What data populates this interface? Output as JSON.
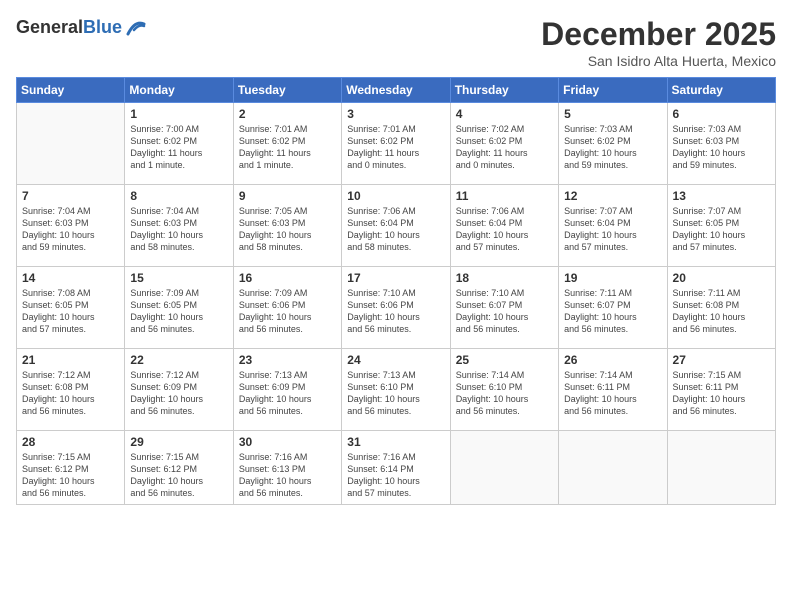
{
  "logo": {
    "general": "General",
    "blue": "Blue"
  },
  "title": "December 2025",
  "location": "San Isidro Alta Huerta, Mexico",
  "days_header": [
    "Sunday",
    "Monday",
    "Tuesday",
    "Wednesday",
    "Thursday",
    "Friday",
    "Saturday"
  ],
  "weeks": [
    [
      {
        "day": "",
        "info": ""
      },
      {
        "day": "1",
        "info": "Sunrise: 7:00 AM\nSunset: 6:02 PM\nDaylight: 11 hours\nand 1 minute."
      },
      {
        "day": "2",
        "info": "Sunrise: 7:01 AM\nSunset: 6:02 PM\nDaylight: 11 hours\nand 1 minute."
      },
      {
        "day": "3",
        "info": "Sunrise: 7:01 AM\nSunset: 6:02 PM\nDaylight: 11 hours\nand 0 minutes."
      },
      {
        "day": "4",
        "info": "Sunrise: 7:02 AM\nSunset: 6:02 PM\nDaylight: 11 hours\nand 0 minutes."
      },
      {
        "day": "5",
        "info": "Sunrise: 7:03 AM\nSunset: 6:02 PM\nDaylight: 10 hours\nand 59 minutes."
      },
      {
        "day": "6",
        "info": "Sunrise: 7:03 AM\nSunset: 6:03 PM\nDaylight: 10 hours\nand 59 minutes."
      }
    ],
    [
      {
        "day": "7",
        "info": "Sunrise: 7:04 AM\nSunset: 6:03 PM\nDaylight: 10 hours\nand 59 minutes."
      },
      {
        "day": "8",
        "info": "Sunrise: 7:04 AM\nSunset: 6:03 PM\nDaylight: 10 hours\nand 58 minutes."
      },
      {
        "day": "9",
        "info": "Sunrise: 7:05 AM\nSunset: 6:03 PM\nDaylight: 10 hours\nand 58 minutes."
      },
      {
        "day": "10",
        "info": "Sunrise: 7:06 AM\nSunset: 6:04 PM\nDaylight: 10 hours\nand 58 minutes."
      },
      {
        "day": "11",
        "info": "Sunrise: 7:06 AM\nSunset: 6:04 PM\nDaylight: 10 hours\nand 57 minutes."
      },
      {
        "day": "12",
        "info": "Sunrise: 7:07 AM\nSunset: 6:04 PM\nDaylight: 10 hours\nand 57 minutes."
      },
      {
        "day": "13",
        "info": "Sunrise: 7:07 AM\nSunset: 6:05 PM\nDaylight: 10 hours\nand 57 minutes."
      }
    ],
    [
      {
        "day": "14",
        "info": "Sunrise: 7:08 AM\nSunset: 6:05 PM\nDaylight: 10 hours\nand 57 minutes."
      },
      {
        "day": "15",
        "info": "Sunrise: 7:09 AM\nSunset: 6:05 PM\nDaylight: 10 hours\nand 56 minutes."
      },
      {
        "day": "16",
        "info": "Sunrise: 7:09 AM\nSunset: 6:06 PM\nDaylight: 10 hours\nand 56 minutes."
      },
      {
        "day": "17",
        "info": "Sunrise: 7:10 AM\nSunset: 6:06 PM\nDaylight: 10 hours\nand 56 minutes."
      },
      {
        "day": "18",
        "info": "Sunrise: 7:10 AM\nSunset: 6:07 PM\nDaylight: 10 hours\nand 56 minutes."
      },
      {
        "day": "19",
        "info": "Sunrise: 7:11 AM\nSunset: 6:07 PM\nDaylight: 10 hours\nand 56 minutes."
      },
      {
        "day": "20",
        "info": "Sunrise: 7:11 AM\nSunset: 6:08 PM\nDaylight: 10 hours\nand 56 minutes."
      }
    ],
    [
      {
        "day": "21",
        "info": "Sunrise: 7:12 AM\nSunset: 6:08 PM\nDaylight: 10 hours\nand 56 minutes."
      },
      {
        "day": "22",
        "info": "Sunrise: 7:12 AM\nSunset: 6:09 PM\nDaylight: 10 hours\nand 56 minutes."
      },
      {
        "day": "23",
        "info": "Sunrise: 7:13 AM\nSunset: 6:09 PM\nDaylight: 10 hours\nand 56 minutes."
      },
      {
        "day": "24",
        "info": "Sunrise: 7:13 AM\nSunset: 6:10 PM\nDaylight: 10 hours\nand 56 minutes."
      },
      {
        "day": "25",
        "info": "Sunrise: 7:14 AM\nSunset: 6:10 PM\nDaylight: 10 hours\nand 56 minutes."
      },
      {
        "day": "26",
        "info": "Sunrise: 7:14 AM\nSunset: 6:11 PM\nDaylight: 10 hours\nand 56 minutes."
      },
      {
        "day": "27",
        "info": "Sunrise: 7:15 AM\nSunset: 6:11 PM\nDaylight: 10 hours\nand 56 minutes."
      }
    ],
    [
      {
        "day": "28",
        "info": "Sunrise: 7:15 AM\nSunset: 6:12 PM\nDaylight: 10 hours\nand 56 minutes."
      },
      {
        "day": "29",
        "info": "Sunrise: 7:15 AM\nSunset: 6:12 PM\nDaylight: 10 hours\nand 56 minutes."
      },
      {
        "day": "30",
        "info": "Sunrise: 7:16 AM\nSunset: 6:13 PM\nDaylight: 10 hours\nand 56 minutes."
      },
      {
        "day": "31",
        "info": "Sunrise: 7:16 AM\nSunset: 6:14 PM\nDaylight: 10 hours\nand 57 minutes."
      },
      {
        "day": "",
        "info": ""
      },
      {
        "day": "",
        "info": ""
      },
      {
        "day": "",
        "info": ""
      }
    ]
  ]
}
